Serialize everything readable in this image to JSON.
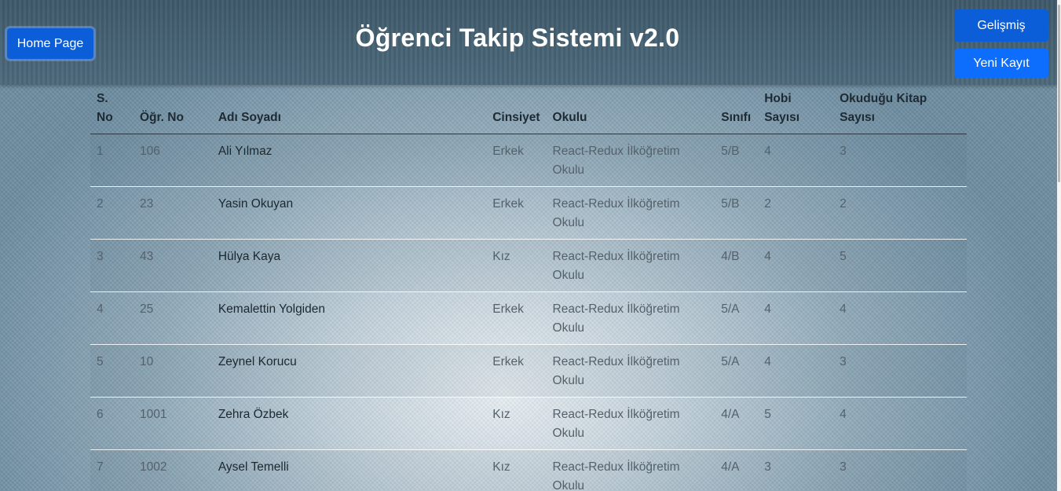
{
  "header": {
    "title": "Öğrenci Takip Sistemi v2.0",
    "home_label": "Home Page",
    "advanced_label": "Gelişmiş",
    "new_record_label": "Yeni Kayıt"
  },
  "table": {
    "columns": [
      "S. No",
      "Öğr. No",
      "Adı Soyadı",
      "Cinsiyet",
      "Okulu",
      "Sınıfı",
      "Hobi Sayısı",
      "Okuduğu Kitap Sayısı"
    ],
    "rows": [
      {
        "sno": "1",
        "ogrno": "106",
        "name": "Ali Yılmaz",
        "gender": "Erkek",
        "school": "React-Redux İlköğretim Okulu",
        "class": "5/B",
        "hobby": "4",
        "books": "3"
      },
      {
        "sno": "2",
        "ogrno": "23",
        "name": "Yasin Okuyan",
        "gender": "Erkek",
        "school": "React-Redux İlköğretim Okulu",
        "class": "5/B",
        "hobby": "2",
        "books": "2"
      },
      {
        "sno": "3",
        "ogrno": "43",
        "name": "Hülya Kaya",
        "gender": "Kız",
        "school": "React-Redux İlköğretim Okulu",
        "class": "4/B",
        "hobby": "4",
        "books": "5"
      },
      {
        "sno": "4",
        "ogrno": "25",
        "name": "Kemalettin Yolgiden",
        "gender": "Erkek",
        "school": "React-Redux İlköğretim Okulu",
        "class": "5/A",
        "hobby": "4",
        "books": "4"
      },
      {
        "sno": "5",
        "ogrno": "10",
        "name": "Zeynel Korucu",
        "gender": "Erkek",
        "school": "React-Redux İlköğretim Okulu",
        "class": "5/A",
        "hobby": "4",
        "books": "3"
      },
      {
        "sno": "6",
        "ogrno": "1001",
        "name": "Zehra Özbek",
        "gender": "Kız",
        "school": "React-Redux İlköğretim Okulu",
        "class": "4/A",
        "hobby": "5",
        "books": "4"
      },
      {
        "sno": "7",
        "ogrno": "1002",
        "name": "Aysel Temelli",
        "gender": "Kız",
        "school": "React-Redux İlköğretim Okulu",
        "class": "4/A",
        "hobby": "3",
        "books": "3"
      }
    ]
  }
}
